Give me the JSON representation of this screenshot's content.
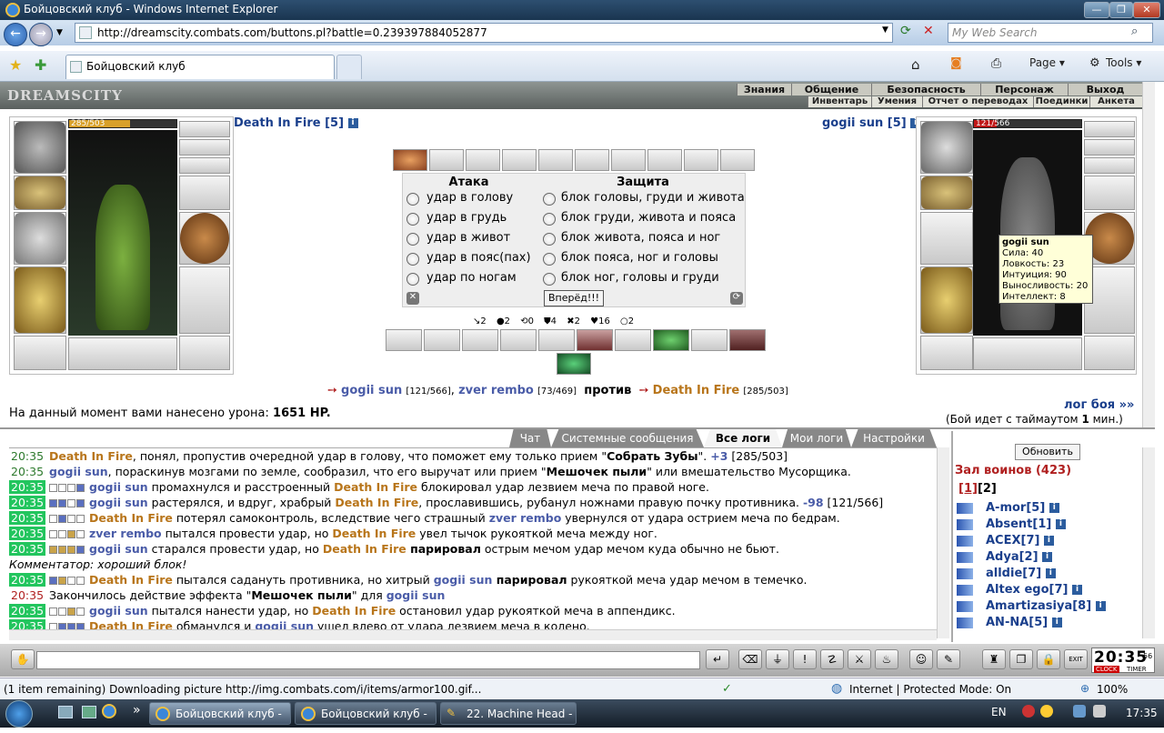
{
  "window": {
    "title": "Бойцовский клуб - Windows Internet Explorer",
    "min": "—",
    "max": "❐",
    "close": "✕"
  },
  "browser": {
    "url": "http://dreamscity.combats.com/buttons.pl?battle=0.239397884052877",
    "search_placeholder": "My Web Search",
    "tab_title": "Бойцовский клуб",
    "page_menu": "Page",
    "tools_menu": "Tools"
  },
  "game_header": {
    "logo": "DREAMSCITY",
    "menu_top": [
      "Знания",
      "Общение",
      "Безопасность",
      "Персонаж",
      "Выход"
    ],
    "menu_bottom": [
      "Инвентарь",
      "Умения",
      "Отчет о переводах",
      "Поединки",
      "Анкета"
    ]
  },
  "player_left": {
    "name": "Death In Fire [5]",
    "hp": "285/503",
    "hp_fraction": 0.567
  },
  "player_right": {
    "name": "gogii sun [5]",
    "hp": "121/566",
    "hp_fraction": 0.214,
    "tooltip": {
      "name": "gogii sun",
      "lines": [
        "Сила: 40",
        "Ловкость: 23",
        "Интуиция: 90",
        "Выносливость: 20",
        "Интеллект: 8"
      ]
    }
  },
  "combat": {
    "attack_header": "Атака",
    "defense_header": "Защита",
    "attacks": [
      "удар в голову",
      "удар в грудь",
      "удар в живот",
      "удар в пояс(пах)",
      "удар по ногам"
    ],
    "blocks": [
      "блок головы, груди и живота",
      "блок груди, живота и пояса",
      "блок живота, пояса и ног",
      "блок пояса, ног и головы",
      "блок ног, головы и груди"
    ],
    "go_button": "Вперёд!!!",
    "counters": [
      "↘2",
      "●2",
      "⟲0",
      "⛊4",
      "✖2",
      "♥16",
      "○2"
    ]
  },
  "versus": {
    "team1": [
      {
        "name": "gogii sun",
        "hp": "[121/566]"
      },
      {
        "name": "zver rembo",
        "hp": "[73/469]"
      }
    ],
    "separator": ",",
    "vs": "против",
    "team2": [
      {
        "name": "Death In Fire",
        "hp": "[285/503]"
      }
    ]
  },
  "damage": {
    "label": "На данный момент вами нанесено урона:",
    "value": "1651 HP."
  },
  "battle_log_link": "лог боя »»",
  "timer_note": {
    "pre": "(Бой идет с таймаутом",
    "num": "1",
    "post": "мин.)"
  },
  "log_tabs": [
    "Чат",
    "Системные сообщения",
    "Все логи",
    "Мои логи",
    "Настройки"
  ],
  "log": [
    {
      "t": "20:35",
      "tc": "tmA",
      "sq": "",
      "parts": [
        [
          "o",
          "Death In Fire"
        ],
        [
          "n",
          ", понял, пропустив очередной удар в голову, что поможет ему только прием \""
        ],
        [
          "b",
          "Собрать Зубы"
        ],
        [
          "n",
          "\". "
        ],
        [
          "c",
          "+3"
        ],
        [
          "n",
          " [285/503]"
        ]
      ]
    },
    {
      "t": "20:35",
      "tc": "tmA",
      "sq": "",
      "parts": [
        [
          "c",
          "gogii sun"
        ],
        [
          "n",
          ", пораскинув мозгами по земле, сообразил, что его выручат или прием \""
        ],
        [
          "b",
          "Мешочек пыли"
        ],
        [
          "n",
          "\" или вмешательство Мусорщика."
        ]
      ]
    },
    {
      "t": "20:35",
      "tc": "tmB",
      "sq": "wwwf",
      "parts": [
        [
          "c",
          "gogii sun"
        ],
        [
          "n",
          " промахнулся и расстроенный "
        ],
        [
          "o",
          "Death In Fire"
        ],
        [
          "n",
          " блокировал удар лезвием меча по правой ноге."
        ]
      ]
    },
    {
      "t": "20:35",
      "tc": "tmB",
      "sq": "ffwf",
      "parts": [
        [
          "c",
          "gogii sun"
        ],
        [
          "n",
          " растерялся, и вдруг, храбрый "
        ],
        [
          "o",
          "Death In Fire"
        ],
        [
          "n",
          ", прославившись, рубанул ножнами правую почку противника. "
        ],
        [
          "c",
          "-98"
        ],
        [
          "n",
          " [121/566]"
        ]
      ]
    },
    {
      "t": "20:35",
      "tc": "tmB",
      "sq": "wfww",
      "parts": [
        [
          "o",
          "Death In Fire"
        ],
        [
          "n",
          " потерял самоконтроль, вследствие чего страшный "
        ],
        [
          "c",
          "zver rembo"
        ],
        [
          "n",
          " увернулся от удара острием меча по бедрам."
        ]
      ]
    },
    {
      "t": "20:35",
      "tc": "tmB",
      "sq": "wwyw",
      "parts": [
        [
          "c",
          "zver rembo"
        ],
        [
          "n",
          " пытался провести удар, но "
        ],
        [
          "o",
          "Death In Fire"
        ],
        [
          "n",
          " увел тычок рукояткой меча между ног."
        ]
      ]
    },
    {
      "t": "20:35",
      "tc": "tmB",
      "sq": "yyyf",
      "parts": [
        [
          "c",
          "gogii sun"
        ],
        [
          "n",
          " старался провести удар, но "
        ],
        [
          "o",
          "Death In Fire"
        ],
        [
          "b",
          " парировал"
        ],
        [
          "n",
          " острым мечом удар мечом куда обычно не бьют."
        ]
      ]
    },
    {
      "t": "",
      "tc": "",
      "sq": "",
      "parts": [
        [
          "i",
          "Комментатор: хороший блок!"
        ]
      ]
    },
    {
      "t": "20:35",
      "tc": "tmB",
      "sq": "fyww",
      "parts": [
        [
          "o",
          "Death In Fire"
        ],
        [
          "n",
          " пытался садануть противника, но хитрый "
        ],
        [
          "c",
          "gogii sun"
        ],
        [
          "b",
          " парировал"
        ],
        [
          "n",
          " рукояткой меча удар мечом в темечко."
        ]
      ]
    },
    {
      "t": "20:35",
      "tc": "tmC",
      "sq": "",
      "parts": [
        [
          "n",
          "Закончилось действие эффекта \""
        ],
        [
          "b",
          "Мешочек пыли"
        ],
        [
          "n",
          "\" для "
        ],
        [
          "c",
          "gogii sun"
        ]
      ]
    },
    {
      "t": "20:35",
      "tc": "tmB",
      "sq": "wwyw",
      "parts": [
        [
          "c",
          "gogii sun"
        ],
        [
          "n",
          " пытался нанести удар, но "
        ],
        [
          "o",
          "Death In Fire"
        ],
        [
          "n",
          " остановил удар рукояткой меча в аппендикс."
        ]
      ]
    },
    {
      "t": "20:35",
      "tc": "tmB",
      "sq": "wfff",
      "parts": [
        [
          "o",
          "Death In Fire"
        ],
        [
          "n",
          " обманулся и "
        ],
        [
          "c",
          "gogii sun"
        ],
        [
          "n",
          " ушел влево от удара лезвием меча в колено."
        ]
      ]
    }
  ],
  "warriors": {
    "refresh": "Обновить",
    "title": "Зал воинов (423)",
    "pages": [
      "[1]",
      "[2]"
    ],
    "list": [
      "A-mor[5]",
      "Absent[1]",
      "ACEX[7]",
      "Adya[2]",
      "alldie[7]",
      "Altex ego[7]",
      "Amartizasiya[8]",
      "AN-NA[5]"
    ]
  },
  "clock": {
    "time": "20:35",
    "sec": "56",
    "label1": "CLOCK",
    "label2": "TIMER",
    "exit": "EXIT"
  },
  "statusbar": {
    "text": "(1 item remaining) Downloading picture http://img.combats.com/i/items/armor100.gif...",
    "zone": "Internet | Protected Mode: On",
    "zoom": "100%"
  },
  "taskbar": {
    "tasks": [
      "Бойцовский клуб - ...",
      "Бойцовский клуб - ...",
      "22. Machine Head - ..."
    ],
    "lang": "EN",
    "time": "17:35"
  }
}
